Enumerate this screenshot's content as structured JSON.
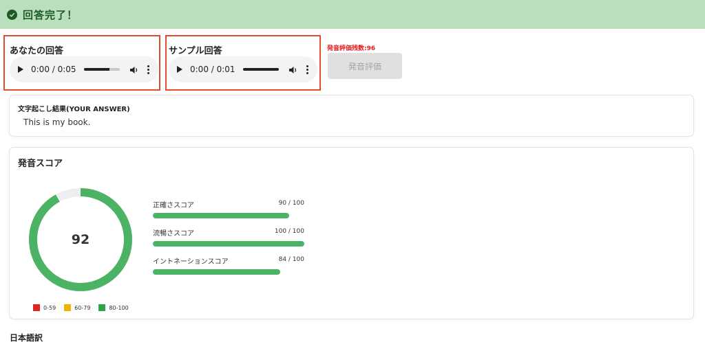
{
  "banner": {
    "title": "回答完了！",
    "bg_color": "#badfbd",
    "text_color": "#1e5b25",
    "icon": "check-circle-icon"
  },
  "your_answer": {
    "label": "あなたの回答",
    "player": {
      "time": "0:00 / 0:05",
      "progress": 0.72
    }
  },
  "sample_answer": {
    "label": "サンプル回答",
    "player": {
      "time": "0:00 / 0:01",
      "progress": 1.0
    }
  },
  "evaluation": {
    "remaining_label": "発音評価残数:96",
    "button_label": "発音評価",
    "button_disabled": true
  },
  "transcription": {
    "title": "文字起こし結果(YOUR ANSWER)",
    "text": "This is my book."
  },
  "score": {
    "title": "発音スコア",
    "overall": "92",
    "overall_value": 92,
    "bars": [
      {
        "label": "正確さスコア",
        "value_text": "90 / 100",
        "value": 90
      },
      {
        "label": "流暢さスコア",
        "value_text": "100 / 100",
        "value": 100
      },
      {
        "label": "イントネーションスコア",
        "value_text": "84 / 100",
        "value": 84
      }
    ],
    "legend": [
      {
        "label": "0-59",
        "color": "#e02424"
      },
      {
        "label": "60-79",
        "color": "#f0b400"
      },
      {
        "label": "80-100",
        "color": "#27a844"
      }
    ],
    "accent_color": "#4cb264"
  },
  "japanese_translation": {
    "title": "日本語訳"
  }
}
